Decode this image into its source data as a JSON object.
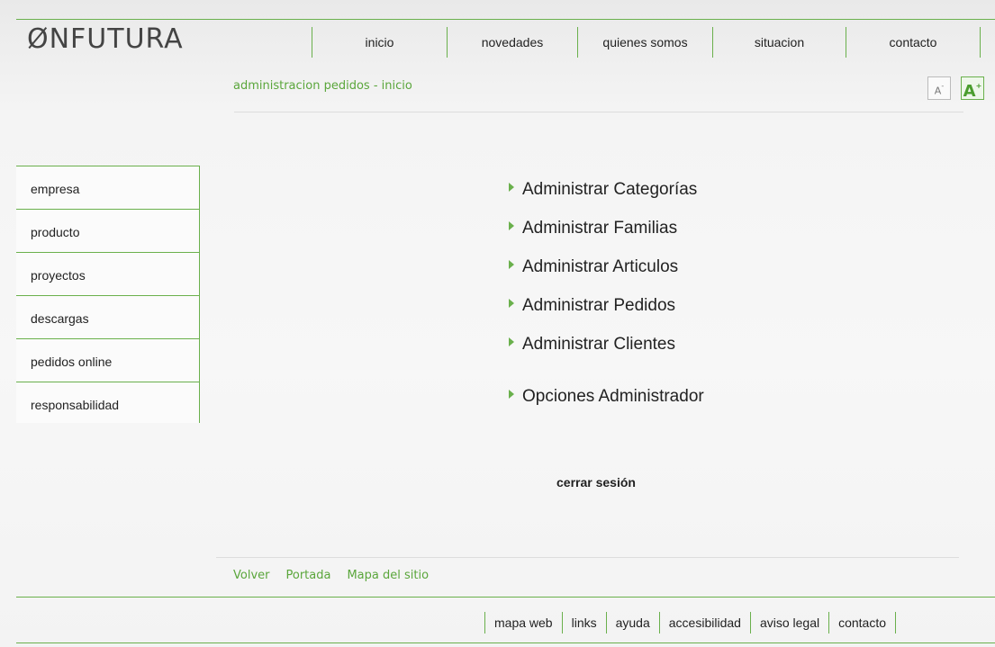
{
  "logo": {
    "text": "ØNFUTURA"
  },
  "nav": {
    "items": [
      "inicio",
      "novedades",
      "quienes somos",
      "situacion",
      "contacto"
    ]
  },
  "breadcrumb": "administracion pedidos - inicio",
  "font_controls": {
    "decrease": "A",
    "increase": "A"
  },
  "sidebar": {
    "items": [
      "empresa",
      "producto",
      "proyectos",
      "descargas",
      "pedidos online",
      "responsabilidad"
    ]
  },
  "admin": {
    "links": [
      "Administrar Categorías",
      "Administrar Familias",
      "Administrar Articulos",
      "Administrar Pedidos",
      "Administrar Clientes",
      "Opciones Administrador"
    ],
    "logout": "cerrar sesión"
  },
  "footer": {
    "links": [
      "Volver",
      "Portada",
      "Mapa del sitio"
    ],
    "bottom_nav": [
      "mapa web",
      "links",
      "ayuda",
      "accesibilidad",
      "aviso legal",
      "contacto"
    ]
  },
  "colors": {
    "accent": "#6ab04c",
    "link_green": "#5aa63b",
    "text": "#222222"
  }
}
